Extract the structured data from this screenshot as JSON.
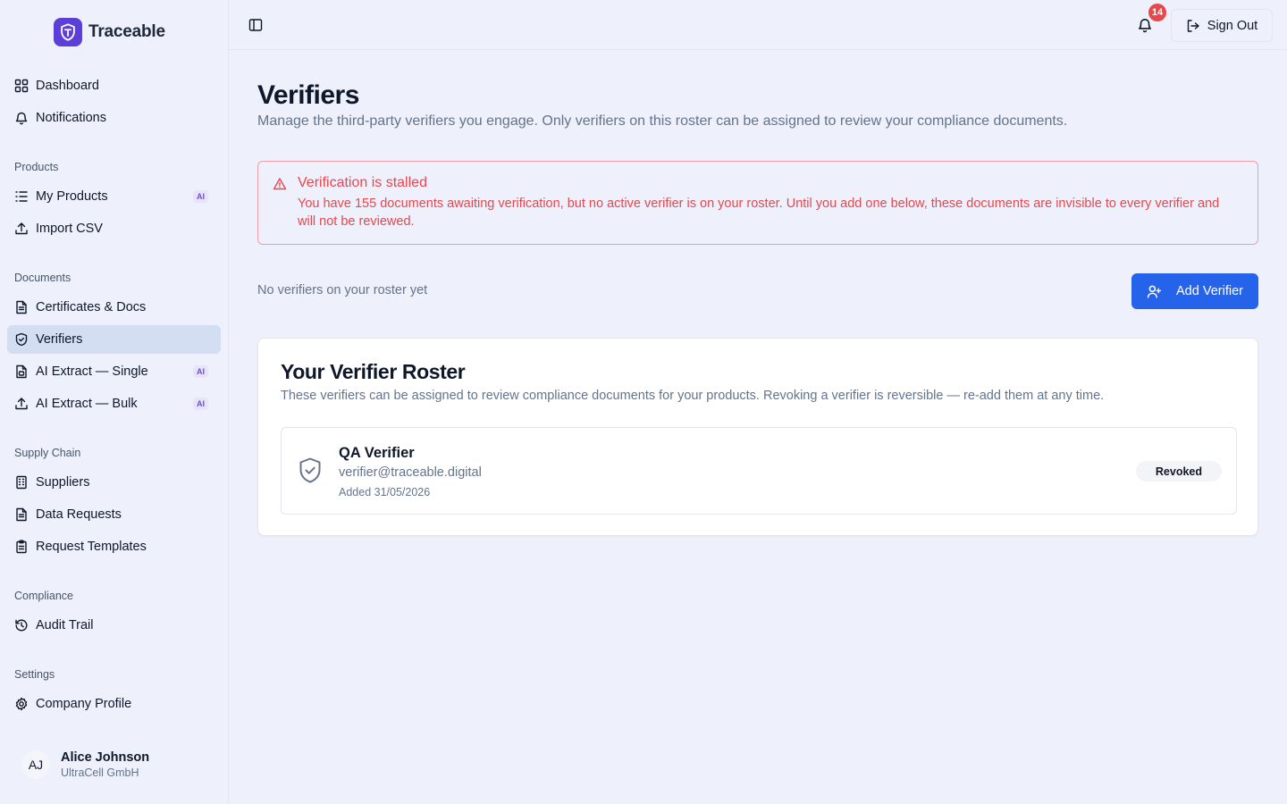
{
  "brand": {
    "name": "Traceable",
    "accent": "#5b3fd6"
  },
  "sidebar": {
    "main_items": [
      {
        "label": "Dashboard",
        "icon": "grid-icon"
      },
      {
        "label": "Notifications",
        "icon": "bell-icon"
      }
    ],
    "sections": {
      "products": "Products",
      "documents": "Documents",
      "supply_chain": "Supply Chain",
      "compliance": "Compliance",
      "settings": "Settings"
    },
    "products_items": [
      {
        "label": "My Products",
        "badge": "AI"
      },
      {
        "label": "Import CSV"
      }
    ],
    "documents_items": [
      {
        "label": "Certificates & Docs"
      },
      {
        "label": "Verifiers",
        "active": true
      },
      {
        "label": "AI Extract — Single",
        "badge": "AI"
      },
      {
        "label": "AI Extract — Bulk",
        "badge": "AI"
      }
    ],
    "supply_items": [
      {
        "label": "Suppliers"
      },
      {
        "label": "Data Requests"
      },
      {
        "label": "Request Templates"
      }
    ],
    "compliance_items": [
      {
        "label": "Audit Trail"
      }
    ],
    "settings_items": [
      {
        "label": "Company Profile"
      }
    ],
    "user": {
      "initials": "AJ",
      "name": "Alice Johnson",
      "org": "UltraCell GmbH"
    }
  },
  "topbar": {
    "notification_count": "14",
    "sign_out_label": "Sign Out"
  },
  "main": {
    "title": "Verifiers",
    "subtitle": "Manage the third-party verifiers you engage. Only verifiers on this roster can be assigned to review your compliance documents.",
    "alert": {
      "title": "Verification is stalled",
      "body": "You have 155 documents awaiting verification, but no active verifier is on your roster. Until you add one below, these documents are invisible to every verifier and will not be reviewed.",
      "color": "#e5484d"
    },
    "empty_text": "No verifiers on your roster yet",
    "add_button_label": "Add Verifier",
    "roster": {
      "title": "Your Verifier Roster",
      "description": "These verifiers can be assigned to review compliance documents for your products. Revoking a verifier is reversible — re-add them at any time.",
      "verifiers": [
        {
          "name": "QA Verifier",
          "email": "verifier@traceable.digital",
          "added": "Added 31/05/2026",
          "status": "Revoked"
        }
      ]
    }
  },
  "colors": {
    "primary_button": "#2663eb",
    "active_nav": "#d3def3"
  }
}
